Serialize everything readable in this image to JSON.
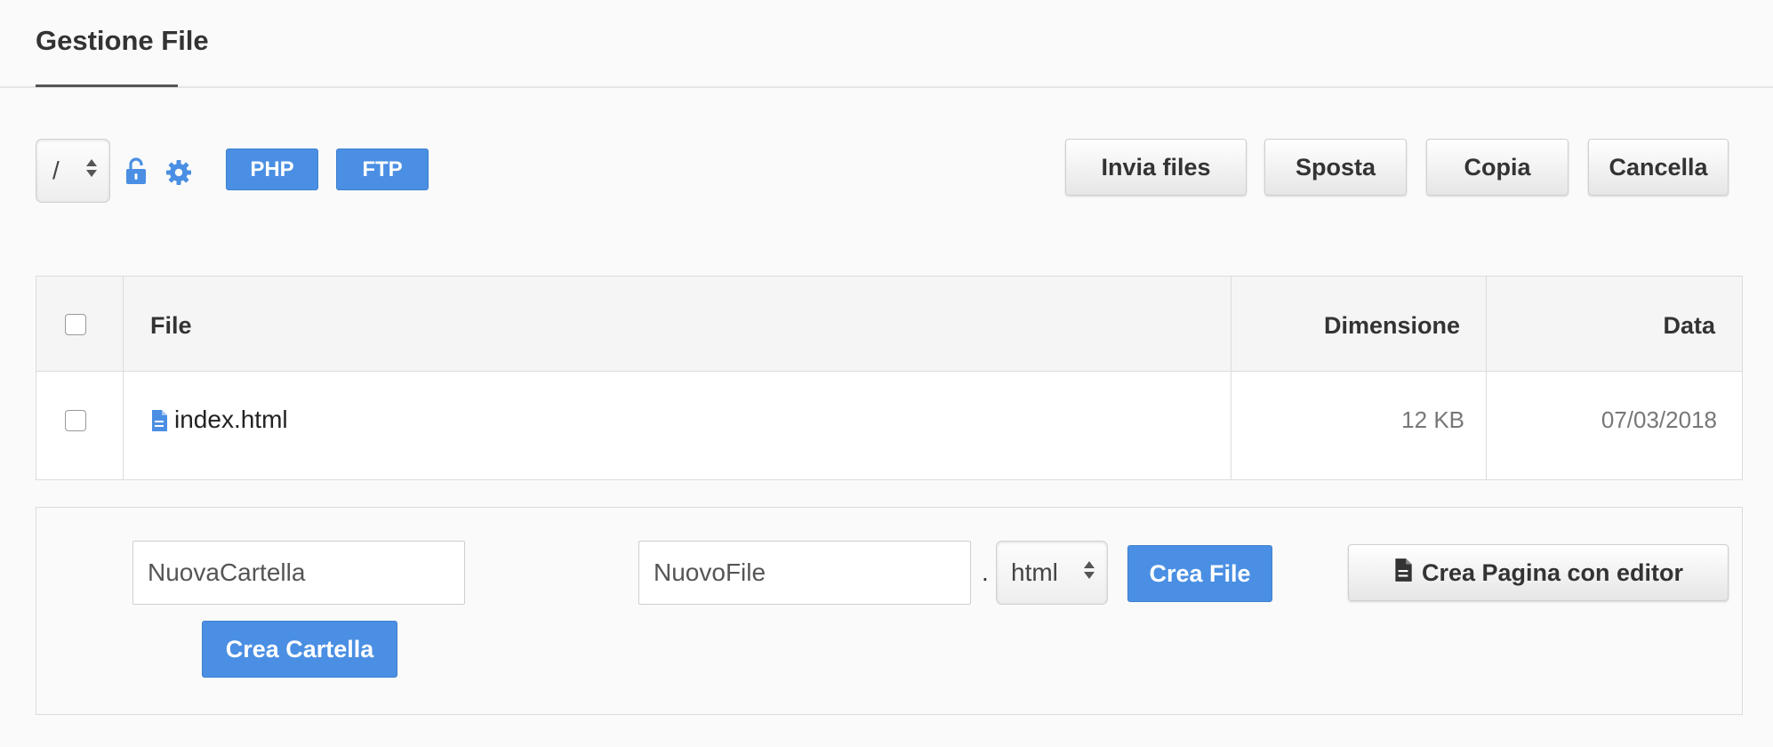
{
  "header": {
    "title": "Gestione File"
  },
  "toolbar": {
    "path_value": "/",
    "lock_icon": "unlock-icon",
    "gear_icon": "gear-icon",
    "php_label": "PHP",
    "ftp_label": "FTP",
    "send_label": "Invia files",
    "move_label": "Sposta",
    "copy_label": "Copia",
    "delete_label": "Cancella",
    "accent_color": "#4a8fe3"
  },
  "table": {
    "columns": [
      "File",
      "Dimensione",
      "Data"
    ],
    "rows": [
      {
        "icon": "file-text-icon",
        "name": "index.html",
        "size": "12 KB",
        "date": "07/03/2018"
      }
    ]
  },
  "create": {
    "folder_input_value": "NuovaCartella",
    "folder_button": "Crea Cartella",
    "file_input_value": "NuovoFile",
    "separator": ".",
    "ext_value": "html",
    "file_button": "Crea File",
    "editor_icon": "file-text-icon",
    "editor_button": "Crea Pagina con editor"
  }
}
